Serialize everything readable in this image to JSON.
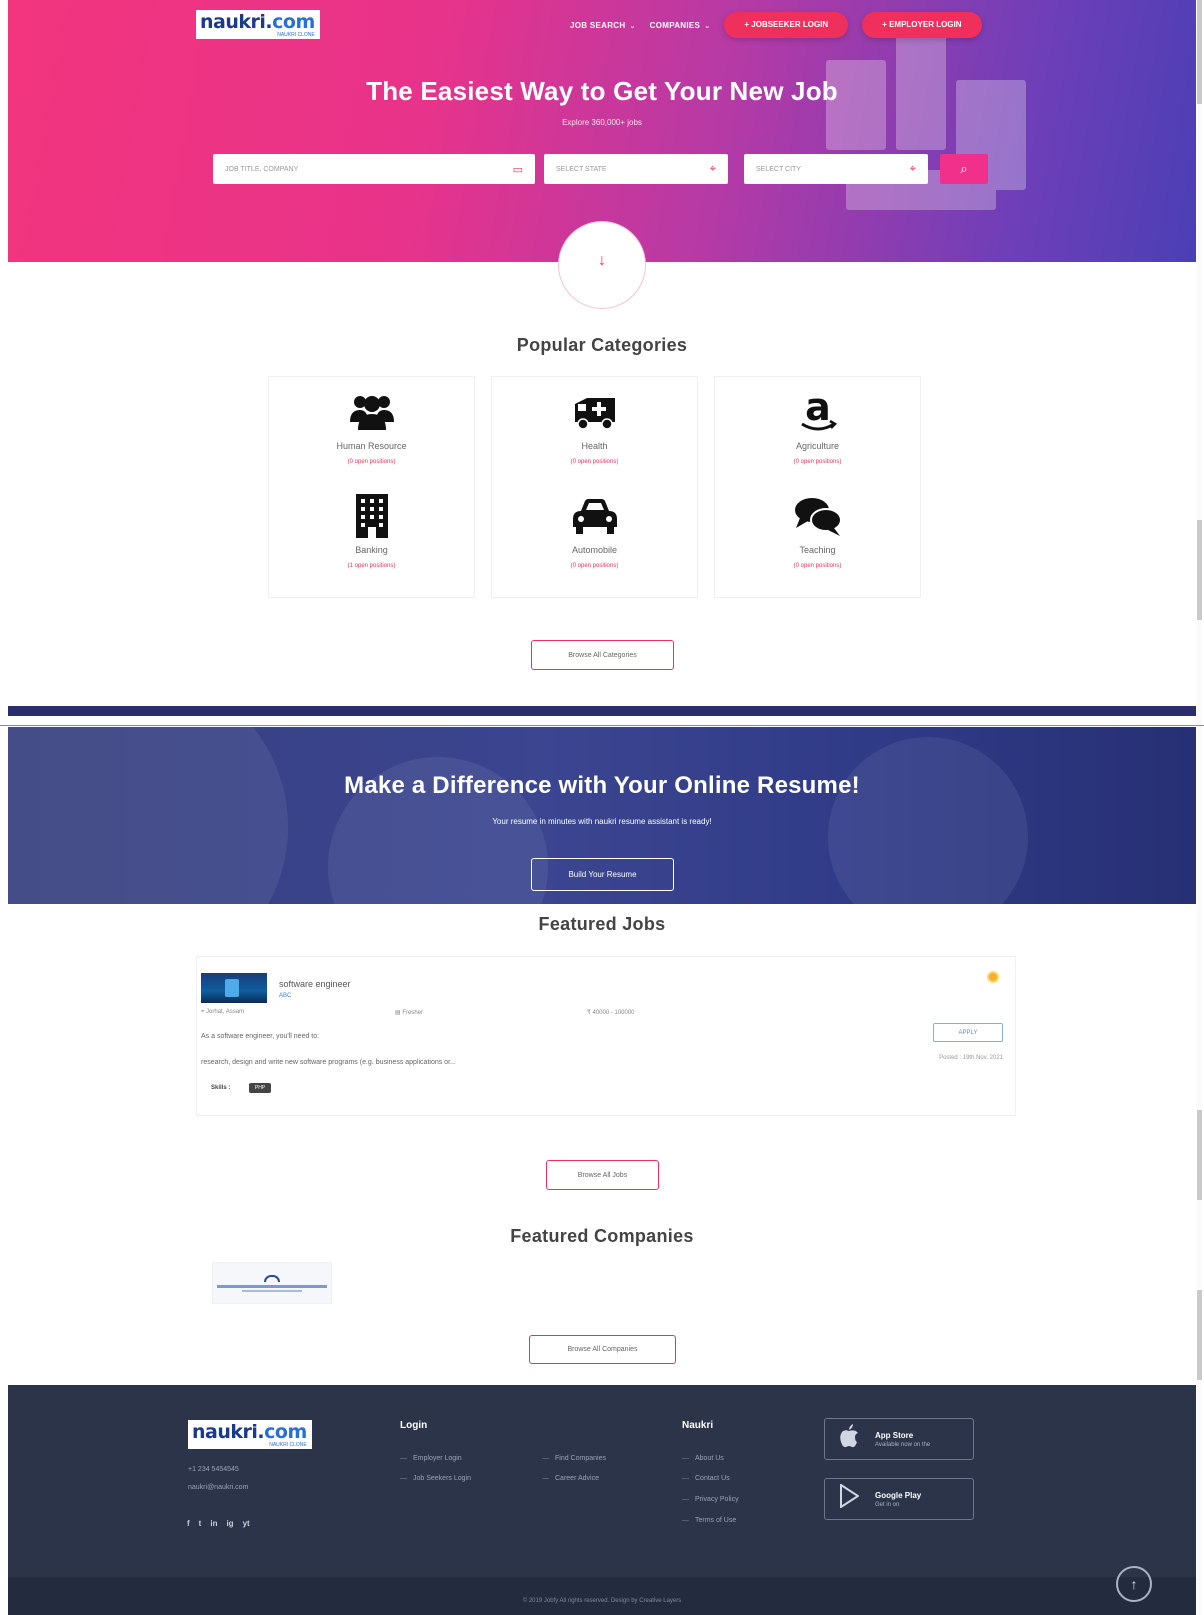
{
  "brand": {
    "logo_word": "naukri",
    "logo_dot": ".",
    "logo_com": "com",
    "logo_tag": "NAUKRI CLONE",
    "accent_color": "#f0305c",
    "footer_color": "#2b3449"
  },
  "nav": {
    "job_search": "JOB SEARCH",
    "companies": "COMPANIES",
    "jobseeker_login": "JOBSEEKER LOGIN",
    "employer_login": "EMPLOYER LOGIN",
    "caret_icon": "chevron-down-icon"
  },
  "hero": {
    "title": "The Easiest Way to Get Your New Job",
    "subtitle": "Explore 360,000+ jobs",
    "keyword_placeholder": "JOB TITLE, COMPANY",
    "state_placeholder": "SELECT STATE",
    "city_placeholder": "SELECT CITY",
    "search_icon": "search-icon",
    "scroll_icon": "arrow-down-icon"
  },
  "categories": {
    "title": "Popular Categories",
    "items": [
      {
        "name": "Human Resource",
        "count": "(0 open positions)",
        "icon": "users-icon"
      },
      {
        "name": "Health",
        "count": "(0 open positions)",
        "icon": "ambulance-icon"
      },
      {
        "name": "Agriculture",
        "count": "(0 open positions)",
        "icon": "amazon-icon"
      },
      {
        "name": "Banking",
        "count": "(1 open positions)",
        "icon": "building-icon"
      },
      {
        "name": "Automobile",
        "count": "(0 open positions)",
        "icon": "car-icon"
      },
      {
        "name": "Teaching",
        "count": "(0 open positions)",
        "icon": "comments-icon"
      }
    ],
    "browse_label": "Browse All Categories"
  },
  "resume": {
    "title": "Make a Difference with Your Online Resume!",
    "subtitle": "Your resume in minutes with naukri resume assistant is ready!",
    "button_label": "Build Your Resume"
  },
  "featured_jobs": {
    "title": "Featured Jobs",
    "jobs": [
      {
        "title": "software engineer",
        "company": "ABC",
        "location": "Jorhat, Assam",
        "type": "Fresher",
        "salary": "40000 - 100000",
        "desc_line1": "As a software engineer, you'll need to:",
        "desc_line2": "research, design and write new software programs (e.g. business applications or...",
        "skills_label": "Skills :",
        "skill": "PHP",
        "apply_label": "APPLY",
        "posted": "Posted : 19th Nov, 2021"
      }
    ],
    "browse_label": "Browse All Jobs"
  },
  "featured_companies": {
    "title": "Featured Companies",
    "browse_label": "Browse All Companies"
  },
  "footer": {
    "phone": "+1 234 5454545",
    "email": "naukri@naukri.com",
    "login_head": "Login",
    "login_links": [
      "Employer Login",
      "Job Seekers Login"
    ],
    "login_links2": [
      "Find Companies",
      "Career Advice"
    ],
    "naukri_head": "Naukri",
    "naukri_links": [
      "About Us",
      "Contact Us",
      "Privacy Policy",
      "Terms of Use"
    ],
    "app_store_name": "App Store",
    "app_store_sub": "Available now on the",
    "google_play_name": "Google Play",
    "google_play_sub": "Get in on",
    "social": [
      "f",
      "t",
      "in",
      "ig",
      "yt"
    ],
    "copyright": "© 2019 Jobfy All rights reserved. Design by Creative Layers"
  }
}
